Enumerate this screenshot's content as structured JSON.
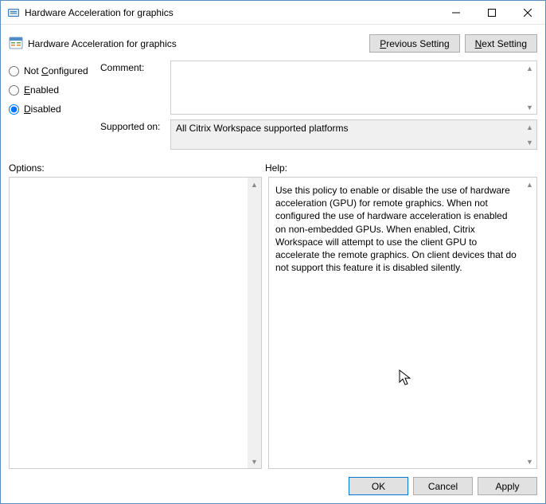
{
  "window": {
    "title": "Hardware Acceleration for graphics"
  },
  "header": {
    "policy_title": "Hardware Acceleration for graphics",
    "previous_label_pre": "P",
    "previous_label_rest": "revious Setting",
    "next_label_pre": "N",
    "next_label_rest": "ext Setting"
  },
  "radios": {
    "not_configured_pre": "Not ",
    "not_configured_accel": "C",
    "not_configured_rest": "onfigured",
    "enabled_accel": "E",
    "enabled_rest": "nabled",
    "disabled_accel": "D",
    "disabled_rest": "isabled",
    "selected": "disabled"
  },
  "fields": {
    "comment_label": "Comment:",
    "comment_value": "",
    "supported_label": "Supported on:",
    "supported_value": "All Citrix Workspace supported platforms"
  },
  "sections": {
    "options_label": "Options:",
    "help_label": "Help:"
  },
  "help_text": "Use this policy to enable or disable the use of hardware acceleration (GPU) for remote graphics. When not configured the use of hardware acceleration is enabled on non-embedded GPUs. When enabled, Citrix Workspace will attempt to use the client GPU to accelerate the remote graphics. On client devices that do not support this feature it is disabled silently.",
  "footer": {
    "ok": "OK",
    "cancel": "Cancel",
    "apply": "Apply"
  }
}
